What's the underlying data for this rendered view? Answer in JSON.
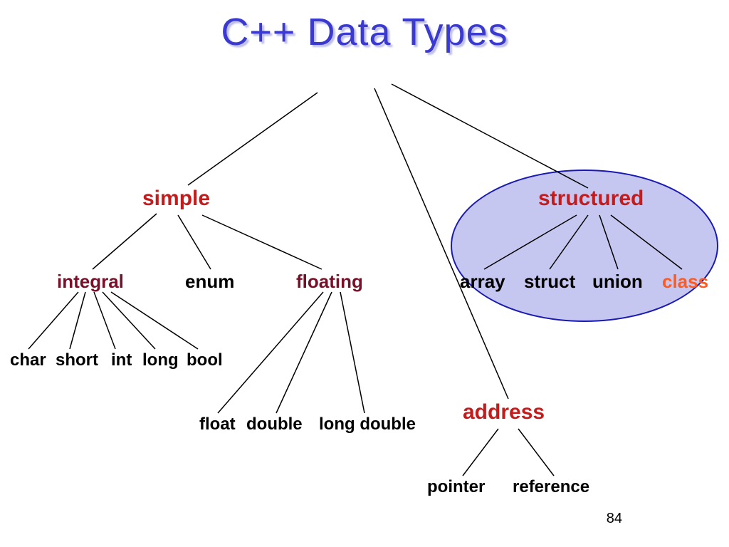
{
  "title": "C++  Data Types",
  "page_number": "84",
  "nodes": {
    "simple": "simple",
    "structured": "structured",
    "integral": "integral",
    "enum": "enum",
    "floating": "floating",
    "array": "array",
    "struct": "struct",
    "union": "union",
    "class": "class",
    "char": "char",
    "short": "short",
    "int": "int",
    "long": "long",
    "bool": "bool",
    "float": "float",
    "double": "double",
    "long_double": "long double",
    "address": "address",
    "pointer": "pointer",
    "reference": "reference"
  }
}
